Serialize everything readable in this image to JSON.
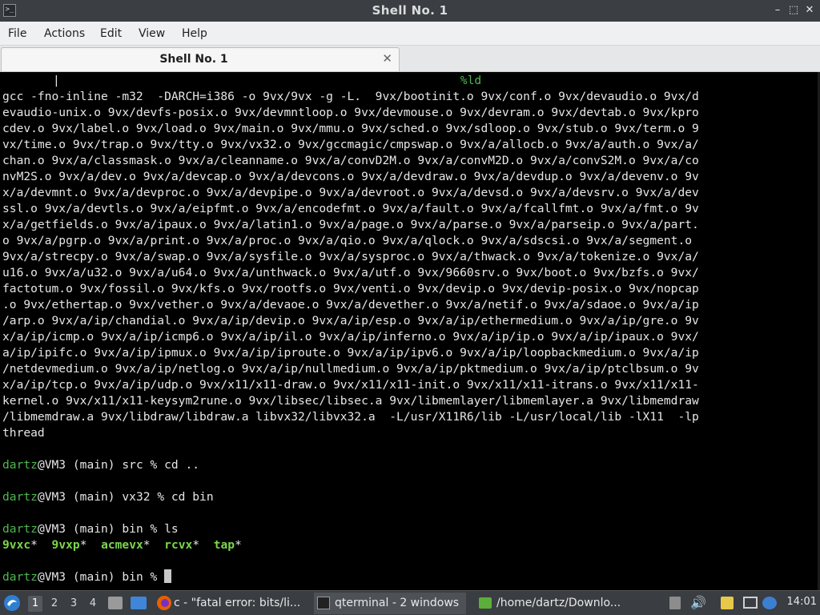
{
  "window": {
    "title": "Shell No. 1",
    "buttons": {
      "minimize": "–",
      "restore": "⬚",
      "close": "✕"
    }
  },
  "menu": [
    "File",
    "Actions",
    "Edit",
    "View",
    "Help"
  ],
  "tab": {
    "label": "Shell No. 1",
    "close": "✕"
  },
  "terminal": {
    "top_pipe": "|",
    "top_token": "%ld",
    "output_lines": [
      "gcc -fno-inline -m32  -DARCH=i386 -o 9vx/9vx -g -L.  9vx/bootinit.o 9vx/conf.o 9vx/devaudio.o 9vx/d",
      "evaudio-unix.o 9vx/devfs-posix.o 9vx/devmntloop.o 9vx/devmouse.o 9vx/devram.o 9vx/devtab.o 9vx/kpro",
      "cdev.o 9vx/label.o 9vx/load.o 9vx/main.o 9vx/mmu.o 9vx/sched.o 9vx/sdloop.o 9vx/stub.o 9vx/term.o 9",
      "vx/time.o 9vx/trap.o 9vx/tty.o 9vx/vx32.o 9vx/gccmagic/cmpswap.o 9vx/a/allocb.o 9vx/a/auth.o 9vx/a/",
      "chan.o 9vx/a/classmask.o 9vx/a/cleanname.o 9vx/a/convD2M.o 9vx/a/convM2D.o 9vx/a/convS2M.o 9vx/a/co",
      "nvM2S.o 9vx/a/dev.o 9vx/a/devcap.o 9vx/a/devcons.o 9vx/a/devdraw.o 9vx/a/devdup.o 9vx/a/devenv.o 9v",
      "x/a/devmnt.o 9vx/a/devproc.o 9vx/a/devpipe.o 9vx/a/devroot.o 9vx/a/devsd.o 9vx/a/devsrv.o 9vx/a/dev",
      "ssl.o 9vx/a/devtls.o 9vx/a/eipfmt.o 9vx/a/encodefmt.o 9vx/a/fault.o 9vx/a/fcallfmt.o 9vx/a/fmt.o 9v",
      "x/a/getfields.o 9vx/a/ipaux.o 9vx/a/latin1.o 9vx/a/page.o 9vx/a/parse.o 9vx/a/parseip.o 9vx/a/part.",
      "o 9vx/a/pgrp.o 9vx/a/print.o 9vx/a/proc.o 9vx/a/qio.o 9vx/a/qlock.o 9vx/a/sdscsi.o 9vx/a/segment.o ",
      "9vx/a/strecpy.o 9vx/a/swap.o 9vx/a/sysfile.o 9vx/a/sysproc.o 9vx/a/thwack.o 9vx/a/tokenize.o 9vx/a/",
      "u16.o 9vx/a/u32.o 9vx/a/u64.o 9vx/a/unthwack.o 9vx/a/utf.o 9vx/9660srv.o 9vx/boot.o 9vx/bzfs.o 9vx/",
      "factotum.o 9vx/fossil.o 9vx/kfs.o 9vx/rootfs.o 9vx/venti.o 9vx/devip.o 9vx/devip-posix.o 9vx/nopcap",
      ".o 9vx/ethertap.o 9vx/vether.o 9vx/a/devaoe.o 9vx/a/devether.o 9vx/a/netif.o 9vx/a/sdaoe.o 9vx/a/ip",
      "/arp.o 9vx/a/ip/chandial.o 9vx/a/ip/devip.o 9vx/a/ip/esp.o 9vx/a/ip/ethermedium.o 9vx/a/ip/gre.o 9v",
      "x/a/ip/icmp.o 9vx/a/ip/icmp6.o 9vx/a/ip/il.o 9vx/a/ip/inferno.o 9vx/a/ip/ip.o 9vx/a/ip/ipaux.o 9vx/",
      "a/ip/ipifc.o 9vx/a/ip/ipmux.o 9vx/a/ip/iproute.o 9vx/a/ip/ipv6.o 9vx/a/ip/loopbackmedium.o 9vx/a/ip",
      "/netdevmedium.o 9vx/a/ip/netlog.o 9vx/a/ip/nullmedium.o 9vx/a/ip/pktmedium.o 9vx/a/ip/ptclbsum.o 9v",
      "x/a/ip/tcp.o 9vx/a/ip/udp.o 9vx/x11/x11-draw.o 9vx/x11/x11-init.o 9vx/x11/x11-itrans.o 9vx/x11/x11-",
      "kernel.o 9vx/x11/x11-keysym2rune.o 9vx/libsec/libsec.a 9vx/libmemlayer/libmemlayer.a 9vx/libmemdraw",
      "/libmemdraw.a 9vx/libdraw/libdraw.a libvx32/libvx32.a  -L/usr/X11R6/lib -L/usr/local/lib -lX11  -lp",
      "thread"
    ],
    "prompt_user": "dartz",
    "prompt_host": "@VM3 (main) ",
    "commands": [
      {
        "dir": "src",
        "cmd": "cd .."
      },
      {
        "dir": "vx32",
        "cmd": "cd bin"
      },
      {
        "dir": "bin",
        "cmd": "ls"
      }
    ],
    "ls_output": [
      "9vxc",
      "9vxp",
      "acmevx",
      "rcvx",
      "tap"
    ],
    "ls_marker": "*",
    "final_dir": "bin",
    "colors": {
      "user": "#4eb84e",
      "exec": "#7bd64a",
      "background": "#000000",
      "text": "#e6e6e6"
    }
  },
  "taskbar": {
    "workspaces": [
      "1",
      "2",
      "3",
      "4"
    ],
    "tasks": [
      {
        "label": "c - \"fatal error: bits/li...",
        "icon": "firefox-icon"
      },
      {
        "label": "qterminal - 2 windows",
        "icon": "terminal-icon"
      },
      {
        "label": "/home/dartz/Downlo...",
        "icon": "folder-icon"
      }
    ],
    "clock": "14:01"
  }
}
